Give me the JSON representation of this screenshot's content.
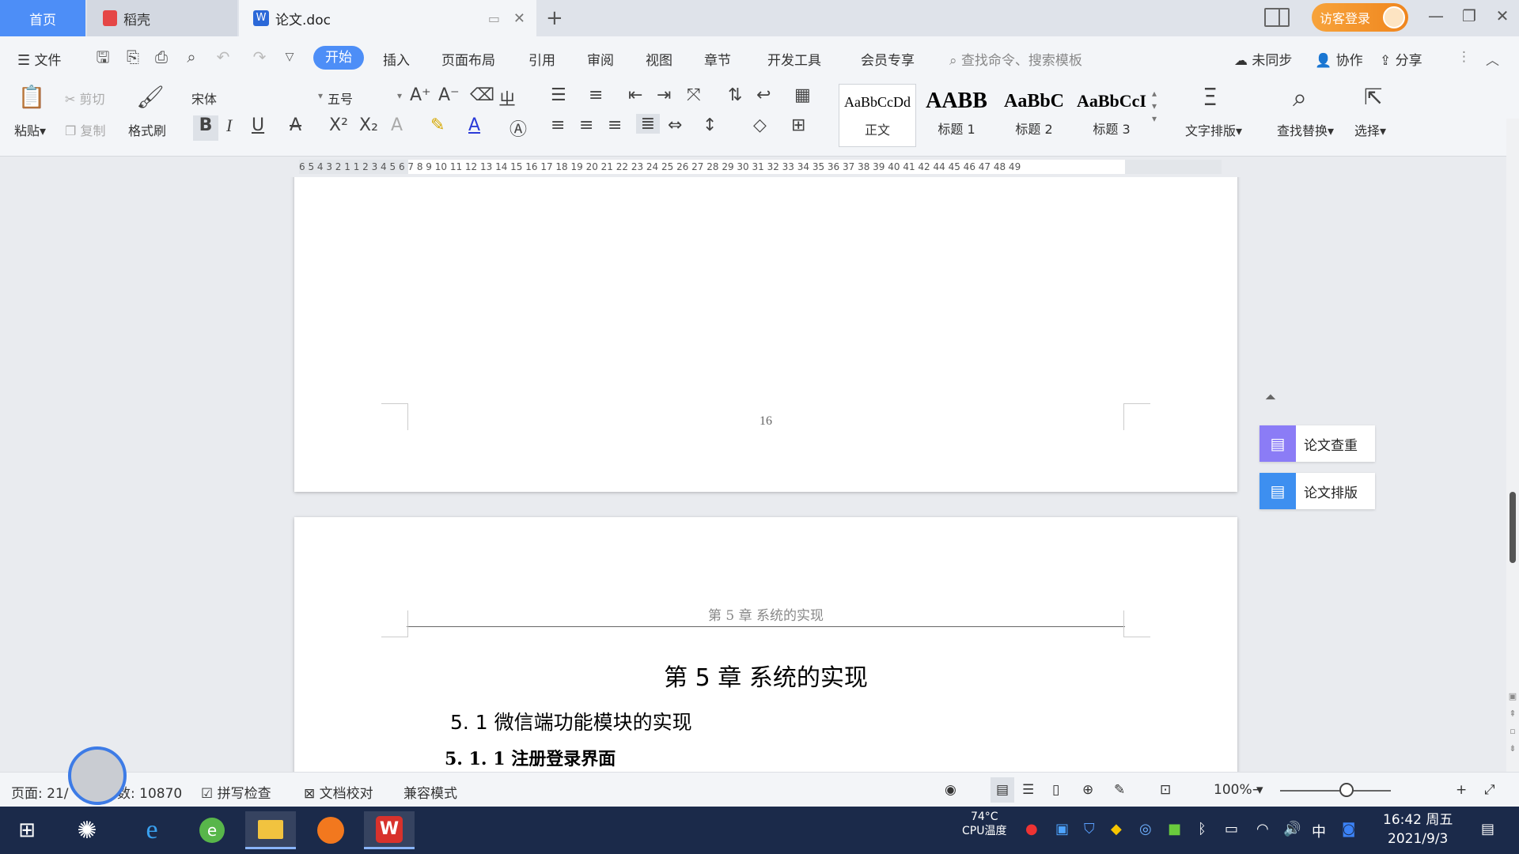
{
  "tabs": {
    "home": "首页",
    "daoke": "稻壳",
    "doc": "论文.doc",
    "new_tab": "+"
  },
  "title_bar": {
    "guest_login": "访客登录"
  },
  "menu": {
    "file": "文件",
    "start": "开始",
    "insert": "插入",
    "page_layout": "页面布局",
    "references": "引用",
    "review": "审阅",
    "view": "视图",
    "chapter": "章节",
    "dev_tools": "开发工具",
    "vip": "会员专享",
    "search_placeholder": "查找命令、搜索模板",
    "not_synced": "未同步",
    "collaborate": "协作",
    "share": "分享"
  },
  "ribbon": {
    "paste": "粘贴",
    "cut": "剪切",
    "copy": "复制",
    "format_painter": "格式刷",
    "font_name": "宋体",
    "font_size": "五号",
    "styles": [
      {
        "preview": "AaBbCcDd",
        "name": "正文"
      },
      {
        "preview": "AABB",
        "name": "标题 1"
      },
      {
        "preview": "AaBbC",
        "name": "标题 2"
      },
      {
        "preview": "AaBbCcI",
        "name": "标题 3"
      }
    ],
    "text_layout": "文字排版",
    "find_replace": "查找替换",
    "select": "选择"
  },
  "ruler": {
    "numbers": "6 5 4 3 2 1   1 2 3 4 5 6 7 8 9 10 11 12 13 14 15 16 17 18 19 20 21 22 23 24 25 26 27 28 29 30 31 32 33 34 35 36 37 38 39 40 41 42   44 45 46 47 48 49"
  },
  "document": {
    "page_number": "16",
    "header_text": "第 5 章  系统的实现",
    "chapter_title": "第 5 章  系统的实现",
    "section_title": "5. 1 微信端功能模块的实现",
    "subsection_title": "5. 1. 1 注册登录界面"
  },
  "side_panel": {
    "thesis_check": "论文查重",
    "thesis_format": "论文排版"
  },
  "status": {
    "page": "页面: 21/",
    "word_count": "数: 10870",
    "spell_check": "拼写检查",
    "doc_proof": "文档校对",
    "compat_mode": "兼容模式",
    "zoom": "100%",
    "zoom_level_fraction": 0.6
  },
  "taskbar": {
    "cpu_temp": "74°C",
    "cpu_label": "CPU温度",
    "ime": "中",
    "time": "16:42 周五",
    "date": "2021/9/3"
  },
  "colors": {
    "accent_blue": "#4d8ef7",
    "guest_orange": "#f0861e",
    "taskbar": "#1b2a4a",
    "purple_icon": "#8b7cf6",
    "blue_icon": "#3d8ff0"
  }
}
